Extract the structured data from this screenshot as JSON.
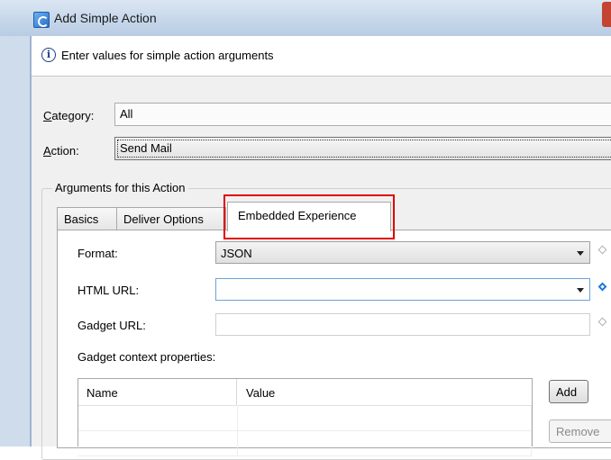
{
  "window": {
    "title": "Add Simple Action"
  },
  "message": "Enter values for simple action arguments",
  "category": {
    "label_prefix": "C",
    "label_rest": "ategory:",
    "value": "All"
  },
  "action": {
    "label_prefix": "A",
    "label_rest": "ction:",
    "value": "Send Mail"
  },
  "group_title": "Arguments for this Action",
  "tabs": [
    {
      "label": "Basics"
    },
    {
      "label": "Deliver Options"
    },
    {
      "label": "Embedded Experience",
      "selected": true
    }
  ],
  "fields": {
    "format": {
      "label": "Format:",
      "value": "JSON"
    },
    "html_url": {
      "label": "HTML URL:",
      "value": ""
    },
    "gadget_url": {
      "label": "Gadget URL:",
      "value": ""
    }
  },
  "context": {
    "label": "Gadget context properties:",
    "columns": [
      "Name",
      "Value"
    ],
    "rows": [
      [
        "",
        ""
      ],
      [
        "",
        ""
      ]
    ]
  },
  "buttons": {
    "add": "Add",
    "remove": "Remove"
  },
  "colors": {
    "highlight": "#e00000",
    "accent": "#1e7bd6"
  }
}
